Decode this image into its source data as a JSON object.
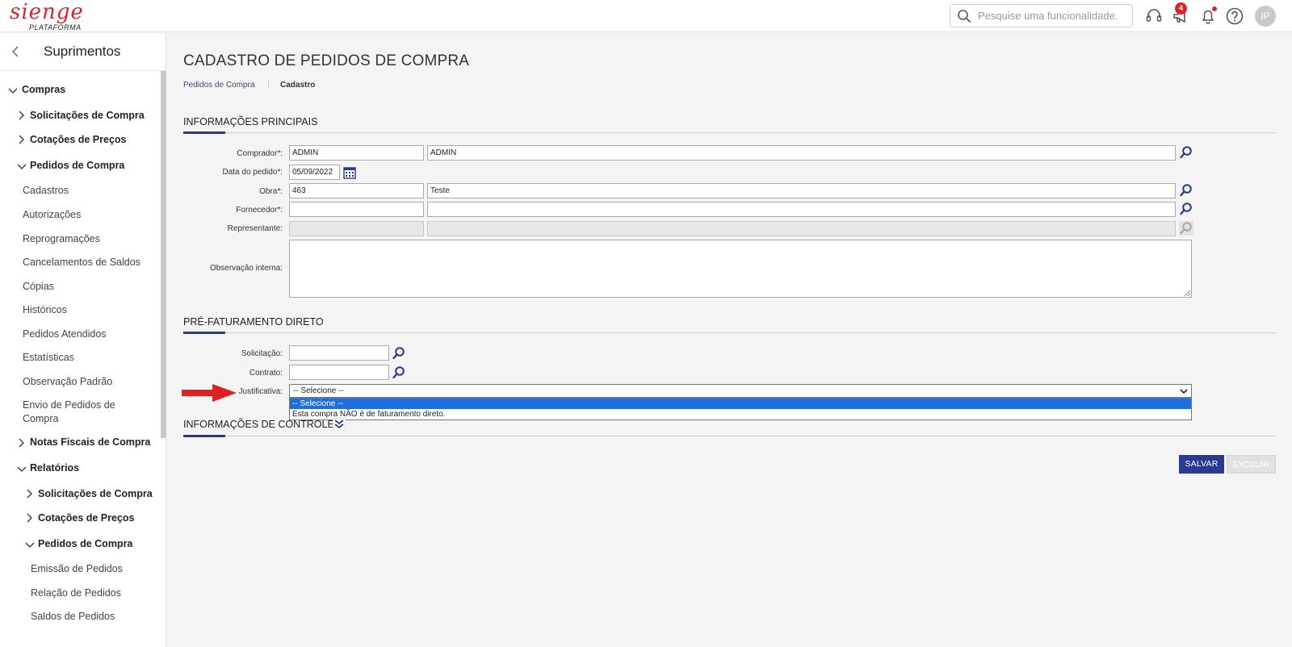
{
  "topbar": {
    "logo_text": "sienge",
    "logo_sub": "PLATAFORMA",
    "search_placeholder": "Pesquise uma funcionalidade.",
    "notifications_count": "4",
    "avatar_initials": "IP"
  },
  "sidebar": {
    "title": "Suprimentos",
    "items": [
      {
        "label": "Compras"
      },
      {
        "label": "Solicitações de Compra"
      },
      {
        "label": "Cotações de Preços"
      },
      {
        "label": "Pedidos de Compra"
      },
      {
        "label": "Cadastros"
      },
      {
        "label": "Autorizações"
      },
      {
        "label": "Reprogramações"
      },
      {
        "label": "Cancelamentos de Saldos"
      },
      {
        "label": "Cópias"
      },
      {
        "label": "Históricos"
      },
      {
        "label": "Pedidos Atendidos"
      },
      {
        "label": "Estatísticas"
      },
      {
        "label": "Observação Padrão"
      },
      {
        "label": "Envio de Pedidos de"
      },
      {
        "label": "Compra"
      },
      {
        "label": "Notas Fiscais de Compra"
      },
      {
        "label": "Relatórios"
      },
      {
        "label": "Solicitações de Compra"
      },
      {
        "label": "Cotações de Preços"
      },
      {
        "label": "Pedidos de Compra"
      },
      {
        "label": "Emissão de Pedidos"
      },
      {
        "label": "Relação de Pedidos"
      },
      {
        "label": "Saldos de Pedidos"
      }
    ]
  },
  "page": {
    "title": "CADASTRO DE PEDIDOS DE COMPRA",
    "breadcrumb": [
      "Pedidos de Compra",
      "Cadastro"
    ]
  },
  "sections": {
    "principal": "INFORMAÇÕES PRINCIPAIS",
    "prefaturamento": "PRÉ-FATURAMENTO DIRETO",
    "controle": "INFORMAÇÕES DE CONTROLE"
  },
  "form": {
    "comprador": {
      "label": "Comprador*:",
      "code": "ADMIN",
      "name": "ADMIN"
    },
    "data_pedido": {
      "label": "Data do pedido*:",
      "value": "05/09/2022"
    },
    "obra": {
      "label": "Obra*:",
      "code": "463",
      "name": "Teste"
    },
    "fornecedor": {
      "label": "Fornecedor*:",
      "code": "",
      "name": ""
    },
    "representante": {
      "label": "Representante:",
      "code": "",
      "name": ""
    },
    "observacao": {
      "label": "Observação interna:",
      "value": ""
    },
    "solicitacao": {
      "label": "Solicitação:",
      "value": ""
    },
    "contrato": {
      "label": "Contrato:",
      "value": ""
    },
    "justificativa": {
      "label": "Justificativa:",
      "selected": "-- Selecione --",
      "options": [
        "-- Selecione --",
        "Esta compra NÃO é de faturamento direto."
      ]
    }
  },
  "buttons": {
    "save": "SALVAR",
    "delete": "EXCLUIR"
  },
  "colors": {
    "brand_red": "#d7262b",
    "primary_navy": "#2b3990",
    "option_highlight": "#1e6fdd",
    "annotation_arrow": "#e02020"
  }
}
